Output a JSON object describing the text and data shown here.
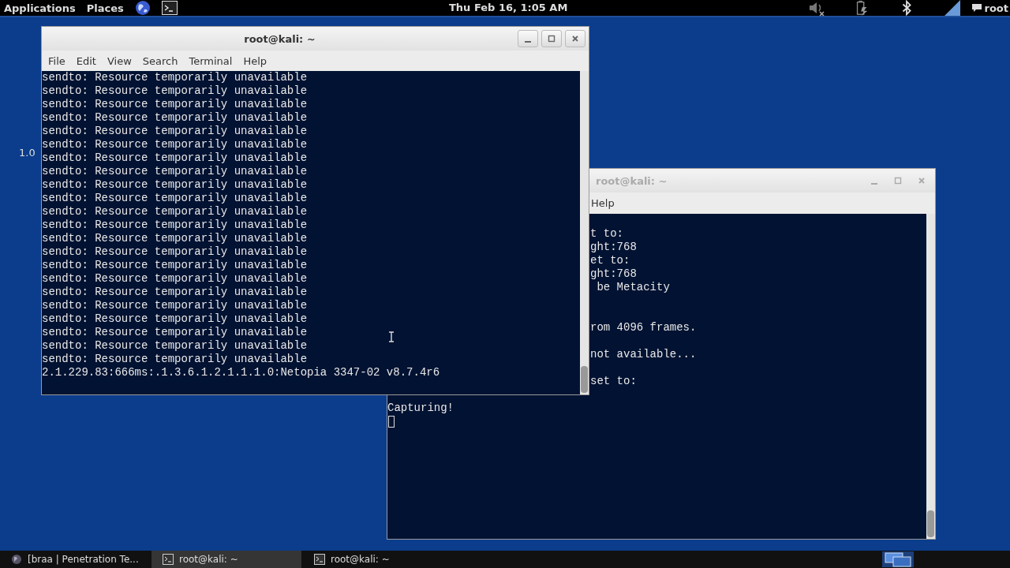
{
  "top_panel": {
    "menus": [
      {
        "label": "Applications"
      },
      {
        "label": "Places"
      }
    ],
    "clock": "Thu Feb 16,  1:05 AM",
    "user": "root"
  },
  "desktop": {
    "label": "1.0"
  },
  "windows": [
    {
      "title": "root@kali: ~",
      "focused": true,
      "cursor_visible": false,
      "menu": [
        "File",
        "Edit",
        "View",
        "Search",
        "Terminal",
        "Help"
      ],
      "lines": [
        {
          "kind": "full",
          "text": "sendto: Resource temporarily unavailable"
        },
        {
          "kind": "full",
          "text": "sendto: Resource temporarily unavailable"
        },
        {
          "kind": "full",
          "text": "sendto: Resource temporarily unavailable"
        },
        {
          "kind": "full",
          "text": "sendto: Resource temporarily unavailable"
        },
        {
          "kind": "full",
          "text": "sendto: Resource temporarily unavailable"
        },
        {
          "kind": "full",
          "text": "sendto: Resource temporarily unavailable"
        },
        {
          "kind": "full",
          "text": "sendto: Resource temporarily unavailable"
        },
        {
          "kind": "full",
          "text": "sendto: Resource temporarily unavailable"
        },
        {
          "kind": "full",
          "text": "sendto: Resource temporarily unavailable"
        },
        {
          "kind": "full",
          "text": "sendto: Resource temporarily unavailable"
        },
        {
          "kind": "full",
          "text": "sendto: Resource temporarily unavailable"
        },
        {
          "kind": "full",
          "text": "sendto: Resource temporarily unavailable"
        },
        {
          "kind": "full",
          "text": "sendto: Resource temporarily unavailable"
        },
        {
          "kind": "full",
          "text": "sendto: Resource temporarily unavailable"
        },
        {
          "kind": "full",
          "text": "sendto: Resource temporarily unavailable"
        },
        {
          "kind": "full",
          "text": "sendto: Resource temporarily unavailable"
        },
        {
          "kind": "full",
          "text": "sendto: Resource temporarily unavailable"
        },
        {
          "kind": "full",
          "text": "sendto: Resource temporarily unavailable"
        },
        {
          "kind": "full",
          "text": "sendto: Resource temporarily unavailable"
        },
        {
          "kind": "full",
          "text": "sendto: Resource temporarily unavailable"
        },
        {
          "kind": "full",
          "text": "sendto: Resource temporarily unavailable"
        },
        {
          "kind": "full",
          "text": "sendto: Resource temporarily unavailable"
        },
        {
          "kind": "full",
          "text": "2.1.229.83:666ms:.1.3.6.1.2.1.1.1.0:Netopia 3347-02 v8.7.4r6"
        }
      ]
    },
    {
      "title": "root@kali: ~",
      "focused": false,
      "cursor_visible": true,
      "menu": [
        "Help"
      ],
      "lines": [
        {
          "kind": "blank"
        },
        {
          "kind": "clipped",
          "text": "t to:"
        },
        {
          "kind": "clipped",
          "text": "ght:768"
        },
        {
          "kind": "clipped",
          "text": "et to:"
        },
        {
          "kind": "clipped",
          "text": "ght:768"
        },
        {
          "kind": "clipped",
          "text": " be Metacity"
        },
        {
          "kind": "blank"
        },
        {
          "kind": "blank"
        },
        {
          "kind": "clipped",
          "text": "rom 4096 frames."
        },
        {
          "kind": "blank"
        },
        {
          "kind": "clipped",
          "text": "not available..."
        },
        {
          "kind": "blank"
        },
        {
          "kind": "clipped",
          "text": "set to:"
        },
        {
          "kind": "blank"
        },
        {
          "kind": "full",
          "text": "Capturing!"
        }
      ]
    }
  ],
  "taskbar": {
    "items": [
      {
        "label": "[braa | Penetration Te...",
        "selected": false,
        "kind": "browser"
      },
      {
        "label": "root@kali: ~",
        "selected": true,
        "kind": "terminal"
      },
      {
        "label": "root@kali: ~",
        "selected": false,
        "kind": "terminal"
      }
    ]
  }
}
